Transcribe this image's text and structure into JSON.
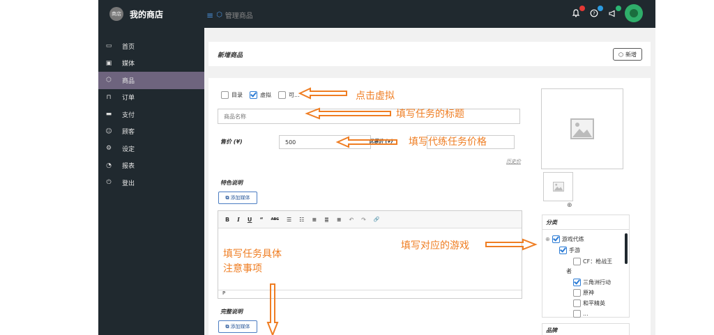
{
  "brand": {
    "name": "我的商店",
    "logo_text": "商店"
  },
  "breadcrumb": {
    "menu_icon": "menu-icon",
    "item_icon": "cube-icon",
    "label": "管理商品"
  },
  "topbar": {
    "icons": [
      {
        "name": "bell-icon",
        "glyph": "🔔"
      },
      {
        "name": "help-icon",
        "glyph": "?"
      },
      {
        "name": "megaphone-icon",
        "glyph": "📢"
      }
    ]
  },
  "sidebar": {
    "items": [
      {
        "label": "首页",
        "icon": "home-icon",
        "glyph": "▭"
      },
      {
        "label": "媒体",
        "icon": "image-icon",
        "glyph": "▣"
      },
      {
        "label": "商品",
        "icon": "cube-icon",
        "glyph": "⬡",
        "active": true
      },
      {
        "label": "订单",
        "icon": "cart-icon",
        "glyph": "⊓"
      },
      {
        "label": "支付",
        "icon": "card-icon",
        "glyph": "▬"
      },
      {
        "label": "顾客",
        "icon": "user-icon",
        "glyph": "☺"
      },
      {
        "label": "设定",
        "icon": "settings-icon",
        "glyph": "⚙"
      },
      {
        "label": "报表",
        "icon": "report-icon",
        "glyph": "◔"
      },
      {
        "label": "登出",
        "icon": "power-icon",
        "glyph": "⏻"
      }
    ]
  },
  "page": {
    "title": "新增商品",
    "new_button": "新增"
  },
  "form": {
    "checkboxes": [
      {
        "label": "目录",
        "checked": false
      },
      {
        "label": "虚拟",
        "checked": true
      },
      {
        "label": "可...",
        "checked": false
      }
    ],
    "name_placeholder": "商品名称",
    "price_label": "售价 (¥)",
    "price_value": "500",
    "discount_label": "优惠价 (¥)",
    "history_link": "历史价",
    "feature_label": "特色说明",
    "add_media": "添加媒体",
    "editor_status": "P",
    "full_label": "完整说明",
    "toolbar": [
      "B",
      "I",
      "U",
      "“",
      "ABC",
      "☰",
      "☷",
      "≡",
      "≣",
      "≡",
      "↶",
      "↷",
      "🔗"
    ]
  },
  "category": {
    "title": "分类",
    "items": [
      {
        "label": "游戏代练",
        "checked": true,
        "level": 0
      },
      {
        "label": "手游",
        "checked": true,
        "level": 1
      },
      {
        "label": "CF：枪战王",
        "checked": false,
        "level": 2
      },
      {
        "label": "者",
        "checked": null,
        "level": 1
      },
      {
        "label": "三角洲行动",
        "checked": true,
        "level": 2
      },
      {
        "label": "原神",
        "checked": false,
        "level": 2
      },
      {
        "label": "和平精英",
        "checked": false,
        "level": 2
      },
      {
        "label": "...",
        "checked": false,
        "level": 2
      }
    ]
  },
  "brand_panel": {
    "title": "品牌"
  },
  "annotations": {
    "click_virtual": "点击虚拟",
    "fill_title": "填写任务的标题",
    "fill_price": "填写代练任务价格",
    "fill_game": "填写对应的游戏",
    "fill_details_line1": "填写任务具体",
    "fill_details_line2": "注意事项"
  },
  "colors": {
    "dark": "#20292f",
    "active": "#6e647e",
    "annotation": "#ef7d22",
    "accent": "#2b7bd5"
  }
}
